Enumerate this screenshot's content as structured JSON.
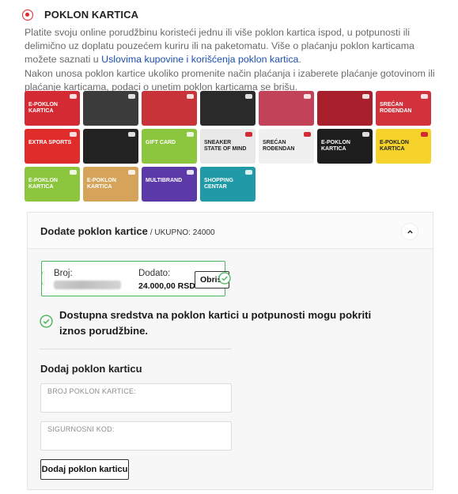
{
  "payment_option": {
    "label": "POKLON KARTICA",
    "selected": true,
    "accent_color": "#e1262d"
  },
  "description": {
    "paragraph1": "Platite svoju online porudžbinu koristeći jednu ili više poklon kartica ispod, u potpunosti ili delimično uz doplatu pouzećem kuriru ili na paketomatu. Više o plaćanju poklon karticama možete saznati u ",
    "link_text": "Uslovima kupovine i korišćenja poklon kartica",
    "paragraph1_end": ".",
    "paragraph2": "Nakon unosa poklon kartice ukoliko promenite način plaćanja i izaberete plaćanje gotovinom ili plaćanje karticama, podaci o unetim poklon karticama se brišu."
  },
  "gift_cards_gallery": [
    {
      "text": "E-POKLON KARTICA",
      "color": "#d42a34"
    },
    {
      "text": "",
      "color": "#3b3b3b"
    },
    {
      "text": "",
      "color": "#c8333a"
    },
    {
      "text": "",
      "color": "#2a2a2a"
    },
    {
      "text": "",
      "color": "#c2425a"
    },
    {
      "text": "",
      "color": "#a8202c"
    },
    {
      "text": "SREĆAN ROĐENDAN",
      "color": "#d2323c"
    },
    {
      "text": "EXTRA SPORTS",
      "color": "#e12c2c"
    },
    {
      "text": "",
      "color": "#222222"
    },
    {
      "text": "GIFT CARD",
      "color": "#8cc63f"
    },
    {
      "text": "SNEAKER STATE OF MIND",
      "color": "#e8e8e8"
    },
    {
      "text": "SREĆAN ROĐENDAN",
      "color": "#f0f0f0"
    },
    {
      "text": "E-POKLON KARTICA",
      "color": "#1e1e1e"
    },
    {
      "text": "E-POKLON KARTICA",
      "color": "#f5d32a"
    },
    {
      "text": "E-POKLON KARTICA",
      "color": "#8cc63f"
    },
    {
      "text": "E-POKLON KARTICA",
      "color": "#d6a35a"
    },
    {
      "text": "MULTIBRAND",
      "color": "#5b3aa8"
    },
    {
      "text": "SHOPPING CENTAR",
      "color": "#1f9aa6"
    }
  ],
  "panel": {
    "title": "Dodate poklon kartice",
    "subtitle": "/ UKUPNO: 24000",
    "added_card": {
      "number_label": "Broj:",
      "added_label": "Dodato:",
      "amount": "24.000,00 RSD",
      "remove_label": "Obriši"
    },
    "info_message": "Dostupna sredstva na poklon kartici u potpunosti mogu pokriti iznos porudžbine.",
    "add_section_title": "Dodaj poklon karticu",
    "card_number_placeholder": "BROJ POKLON KARTICE:",
    "security_code_placeholder": "SIGURNOSNI KOD:",
    "add_button_label": "Dodaj poklon karticu",
    "success_color": "#49b45a"
  }
}
